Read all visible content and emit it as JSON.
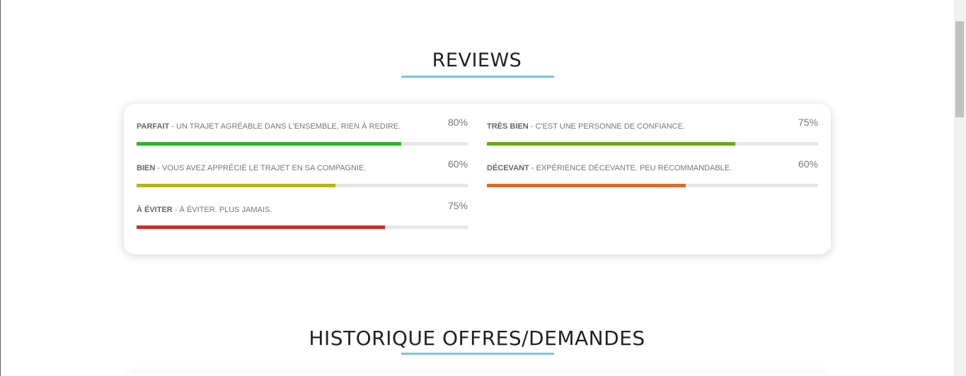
{
  "reviews_section": {
    "title": "REVIEWS",
    "items": [
      {
        "name": "PARFAIT",
        "description": " - UN TRAJET AGRÉABLE DANS L'ENSEMBLE, RIEN À REDIRE.",
        "percent_label": "80%",
        "percent": 80,
        "color": "#2bb42b"
      },
      {
        "name": "TRÈS BIEN",
        "description": " - C'EST UNE PERSONNE DE CONFIANCE.",
        "percent_label": "75%",
        "percent": 75,
        "color": "#6aa816"
      },
      {
        "name": "BIEN",
        "description": " - VOUS AVEZ APPRÉCIÉ LE TRAJET EN SA COMPAGNIE.",
        "percent_label": "60%",
        "percent": 60,
        "color": "#b8b21a"
      },
      {
        "name": "DÉCEVANT",
        "description": " - EXPÉRIENCE DÉCEVANTE. PEU RECOMMANDABLE.",
        "percent_label": "60%",
        "percent": 60,
        "color": "#e06a2b"
      },
      {
        "name": "À ÉVITER",
        "description": " - À ÉVITER. PLUS JAMAIS.",
        "percent_label": "75%",
        "percent": 75,
        "color": "#d02b2b"
      }
    ]
  },
  "history_section": {
    "title": "HISTORIQUE OFFRES/DEMANDES"
  },
  "colors": {
    "accent_underline": "#7dc3dc"
  }
}
